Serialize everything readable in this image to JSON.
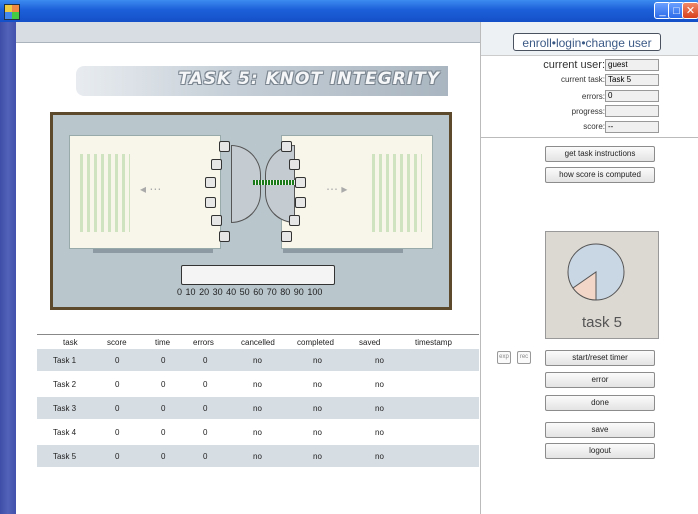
{
  "window": {
    "minimize_icon": "minimize-icon",
    "maximize_icon": "maximize-icon",
    "close_icon": "close-icon",
    "app_icon": "app-icon"
  },
  "task_banner": {
    "title": "TASK 5: KNOT INTEGRITY"
  },
  "game": {
    "scale_labels": [
      "0",
      "10",
      "20",
      "30",
      "40",
      "50",
      "60",
      "70",
      "80",
      "90",
      "100"
    ]
  },
  "table": {
    "headers": [
      "task",
      "score",
      "time",
      "errors",
      "cancelled",
      "completed",
      "saved",
      "timestamp"
    ],
    "rows": [
      [
        "Task 1",
        "0",
        "0",
        "0",
        "no",
        "no",
        "no",
        ""
      ],
      [
        "Task 2",
        "0",
        "0",
        "0",
        "no",
        "no",
        "no",
        ""
      ],
      [
        "Task 3",
        "0",
        "0",
        "0",
        "no",
        "no",
        "no",
        ""
      ],
      [
        "Task 4",
        "0",
        "0",
        "0",
        "no",
        "no",
        "no",
        ""
      ],
      [
        "Task 5",
        "0",
        "0",
        "0",
        "no",
        "no",
        "no",
        ""
      ]
    ]
  },
  "user_menu": {
    "enroll": "enroll",
    "login": "login",
    "change_user": "change user",
    "separator": "•"
  },
  "fields": {
    "current_user_label": "current user:",
    "current_user_value": "guest",
    "current_task_label": "current task:",
    "current_task_value": "Task 5",
    "errors_label": "errors:",
    "errors_value": "0",
    "progress_label": "progress:",
    "progress_value": "",
    "score_label": "score:",
    "score_value": "--"
  },
  "buttons": {
    "get_instructions": "get task instructions",
    "how_score": "how score is computed",
    "start_reset": "start/reset timer",
    "error": "error",
    "done": "done",
    "save": "save",
    "logout": "logout",
    "exp": "exp",
    "rec": "rec"
  },
  "pie": {
    "label": "task 5",
    "colors": {
      "main": "#c9d6e3",
      "slice": "#f2d6c8",
      "outline": "#555555"
    }
  }
}
